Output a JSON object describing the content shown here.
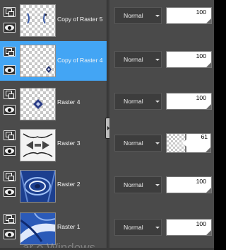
{
  "layers": [
    {
      "name": "Copy of Raster 5",
      "blend_mode": "Normal",
      "opacity": "100",
      "selected": false
    },
    {
      "name": "Copy of Raster 4",
      "blend_mode": "Normal",
      "opacity": "100",
      "selected": true
    },
    {
      "name": "Raster 4",
      "blend_mode": "Normal",
      "opacity": "100",
      "selected": false
    },
    {
      "name": "Raster 3",
      "blend_mode": "Normal",
      "opacity": "61",
      "selected": false
    },
    {
      "name": "Raster 2",
      "blend_mode": "Normal",
      "opacity": "100",
      "selected": false
    },
    {
      "name": "Raster 1",
      "blend_mode": "Normal",
      "opacity": "100",
      "selected": false
    }
  ],
  "watermark": "ar o Windows",
  "colors": {
    "panel": "#4b4b4b",
    "selected": "#43a5f4",
    "text": "#f4f4f4"
  }
}
